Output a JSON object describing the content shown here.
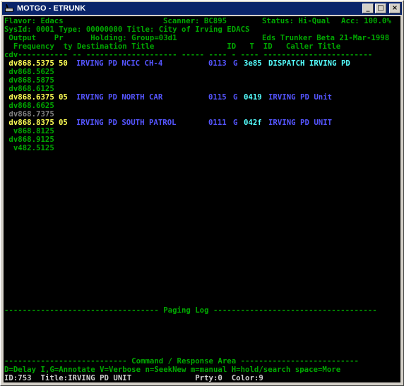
{
  "window": {
    "title": "MOTGO - ETRUNK",
    "minimize": "_",
    "maximize": "□",
    "close": "×"
  },
  "header": {
    "flavor": "Flavor: Edacs",
    "scanner": "Scanner: BC895",
    "status": "Status: Hi-Qual",
    "acc": "Acc: 100.0%",
    "sys_left": "SysId: 0001 Type: 00000000 Title: City of Irving EDACS",
    "out_col": " Output    Pr      Holding: Group=03d1",
    "beta": "Eds Trunker Beta 21-Mar-1998",
    "col_labels": "  Frequency  ty Destination Title                ID   T  ID   Caller Title",
    "dash_line": "cdv----------- -- -------------------- ----- ---- - ---- ------------------------"
  },
  "rows": [
    {
      "freq": " dv868.5375",
      "pr": "50",
      "dest": "IRVING PD NCIC CH-4",
      "gid": "0113",
      "t": "G",
      "cid": "3e85",
      "caller": "DISPATCH IRVING PD",
      "active": true,
      "caller_color": "c"
    },
    {
      "freq": " dv868.5625",
      "inactive": true
    },
    {
      "freq": " dv868.5875",
      "inactive": true
    },
    {
      "freq": " dv868.6125",
      "inactive": true
    },
    {
      "freq": " dv868.6375",
      "pr": "05",
      "dest": "IRVING PD NORTH CAR",
      "gid": "0115",
      "t": "G",
      "cid": "0419",
      "caller": "IRVING PD Unit",
      "active": true,
      "caller_color": "b"
    },
    {
      "freq": " dv868.6625",
      "inactive": true
    },
    {
      "freq": " dv868.7375",
      "inactive": true,
      "dim": true
    },
    {
      "freq": " dv868.8375",
      "pr": "05",
      "dest": "IRVING PD SOUTH PATROL",
      "gid": "0111",
      "t": "G",
      "cid": "042f",
      "caller": "IRVING PD UNIT",
      "active": true,
      "caller_color": "b"
    },
    {
      "freq": "  v868.8125",
      "inactive": true
    },
    {
      "freq": " dv868.9125",
      "inactive": true
    },
    {
      "freq": "  v482.5125",
      "inactive": true
    }
  ],
  "paging_log": "---------------------------------- Paging Log ------------------------------------",
  "command_area": "--------------------------- Command / Response Area --------------------------",
  "help_line": "D=Delay I,G=Annotate V=Verbose n=SeekNew m=manual H=hold/search space=More",
  "status_line": "ID:753  Title:IRVING PD UNIT              Prty:0  Color:9"
}
